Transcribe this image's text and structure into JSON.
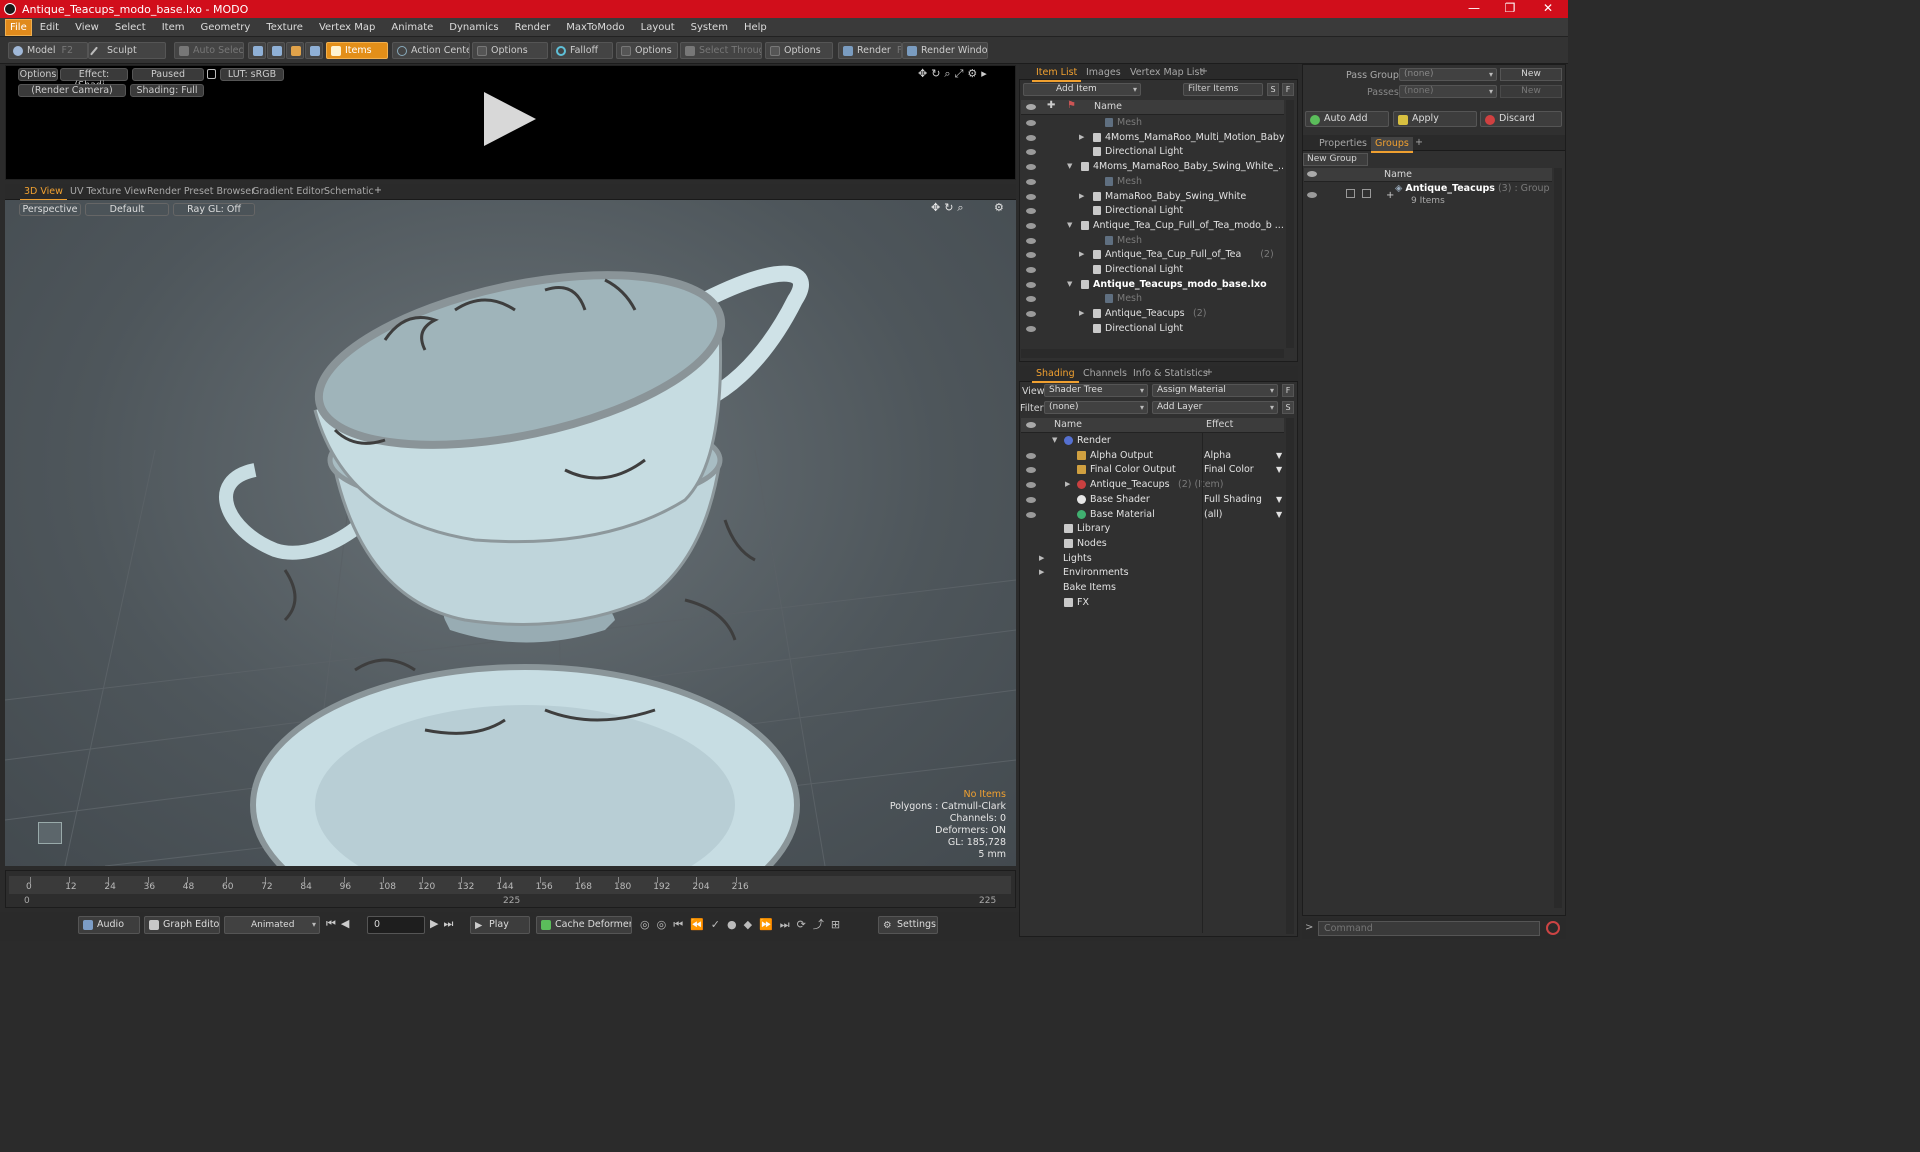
{
  "window": {
    "title": "Antique_Teacups_modo_base.lxo - MODO"
  },
  "menu": [
    "File",
    "Edit",
    "View",
    "Select",
    "Item",
    "Geometry",
    "Texture",
    "Vertex Map",
    "Animate",
    "Dynamics",
    "Render",
    "MaxToModo",
    "Layout",
    "System",
    "Help"
  ],
  "toolbar": {
    "model": "Model",
    "model_key": "F2",
    "sculpt": "Sculpt",
    "auto_select": "Auto Select",
    "items": "Items",
    "action_center": "Action Center",
    "options1": "Options",
    "falloff": "Falloff",
    "options2": "Options",
    "select_through": "Select Through",
    "options3": "Options",
    "render": "Render",
    "render_key": "F9",
    "render_window": "Render Window"
  },
  "preview": {
    "options": "Options",
    "effect": "Effect: (Shadi...",
    "paused": "Paused",
    "lut": "LUT: sRGB",
    "camera": "(Render Camera)",
    "shading": "Shading: Full"
  },
  "viewport_tabs": [
    "3D View",
    "UV Texture View",
    "Render Preset Browser",
    "Gradient Editor",
    "Schematic"
  ],
  "viewport": {
    "perspective": "Perspective",
    "default": "Default",
    "raygl": "Ray GL: Off",
    "stats": {
      "no_items": "No Items",
      "polygons": "Polygons : Catmull-Clark",
      "channels": "Channels: 0",
      "deformers": "Deformers: ON",
      "gl": "GL: 185,728",
      "scale": "5 mm"
    }
  },
  "timeline": {
    "ticks": [
      "0",
      "12",
      "24",
      "36",
      "48",
      "60",
      "72",
      "84",
      "96",
      "108",
      "120",
      "132",
      "144",
      "156",
      "168",
      "180",
      "192",
      "204",
      "216"
    ],
    "start": "0",
    "mid": "225",
    "end": "225"
  },
  "bottom": {
    "audio": "Audio",
    "graph_editor": "Graph Editor",
    "animated": "Animated",
    "frame": "0",
    "play": "Play",
    "cache": "Cache Deformers",
    "settings": "Settings"
  },
  "item_list": {
    "tabs": [
      "Item List",
      "Images",
      "Vertex Map List"
    ],
    "add_item": "Add Item",
    "filter": "Filter Items",
    "col_name": "Name",
    "rows": [
      {
        "label": "Mesh",
        "indent": 3,
        "dim": true
      },
      {
        "label": "4Moms_MamaRoo_Multi_Motion_Baby...",
        "indent": 2,
        "arrow": "▶"
      },
      {
        "label": "Directional Light",
        "indent": 2
      },
      {
        "label": "4Moms_MamaRoo_Baby_Swing_White_...",
        "indent": 1,
        "arrow": "▼"
      },
      {
        "label": "Mesh",
        "indent": 3,
        "dim": true
      },
      {
        "label": "MamaRoo_Baby_Swing_White",
        "indent": 2,
        "arrow": "▶"
      },
      {
        "label": "Directional Light",
        "indent": 2
      },
      {
        "label": "Antique_Tea_Cup_Full_of_Tea_modo_b ...",
        "indent": 1,
        "arrow": "▼"
      },
      {
        "label": "Mesh",
        "indent": 3,
        "dim": true
      },
      {
        "label": "Antique_Tea_Cup_Full_of_Tea",
        "suffix": "(2)",
        "indent": 2,
        "arrow": "▶"
      },
      {
        "label": "Directional Light",
        "indent": 2
      },
      {
        "label": "Antique_Teacups_modo_base.lxo",
        "indent": 1,
        "arrow": "▼",
        "bold": true
      },
      {
        "label": "Mesh",
        "indent": 3,
        "dim": true
      },
      {
        "label": "Antique_Teacups",
        "suffix": "(2)",
        "indent": 2,
        "arrow": "▶"
      },
      {
        "label": "Directional Light",
        "indent": 2
      }
    ]
  },
  "shading": {
    "tabs": [
      "Shading",
      "Channels",
      "Info & Statistics"
    ],
    "view_label": "View",
    "view_value": "Shader Tree",
    "assign_material": "Assign Material",
    "filter_label": "Filter",
    "filter_value": "(none)",
    "add_layer": "Add Layer",
    "col_name": "Name",
    "col_effect": "Effect",
    "rows": [
      {
        "label": "Render",
        "indent": 1,
        "arrow": "▼",
        "effect": ""
      },
      {
        "label": "Alpha Output",
        "indent": 2,
        "effect": "Alpha"
      },
      {
        "label": "Final Color Output",
        "indent": 2,
        "effect": "Final Color"
      },
      {
        "label": "Antique_Teacups",
        "suffix": "(2) (Item)",
        "indent": 2,
        "arrow": "▶",
        "effect": ""
      },
      {
        "label": "Base Shader",
        "indent": 2,
        "effect": "Full Shading"
      },
      {
        "label": "Base Material",
        "indent": 2,
        "effect": "(all)"
      },
      {
        "label": "Library",
        "indent": 1,
        "effect": ""
      },
      {
        "label": "Nodes",
        "indent": 1,
        "effect": ""
      },
      {
        "label": "Lights",
        "indent": 0,
        "arrow": "▶",
        "effect": ""
      },
      {
        "label": "Environments",
        "indent": 0,
        "arrow": "▶",
        "effect": ""
      },
      {
        "label": "Bake Items",
        "indent": 0,
        "effect": ""
      },
      {
        "label": "FX",
        "indent": 1,
        "effect": ""
      }
    ]
  },
  "groups": {
    "pass_groups": "Pass Groups",
    "pass_value": "(none)",
    "new": "New",
    "passes": "Passes",
    "passes_value": "(none)",
    "new2": "New",
    "auto_add": "Auto Add",
    "apply": "Apply",
    "discard": "Discard",
    "tabs": [
      "Properties",
      "Groups"
    ],
    "new_group": "New Group",
    "col_name": "Name",
    "group_name": "Antique_Teacups",
    "group_suffix": "(3) : Group",
    "group_items": "9 Items"
  },
  "command": {
    "placeholder": "Command"
  }
}
